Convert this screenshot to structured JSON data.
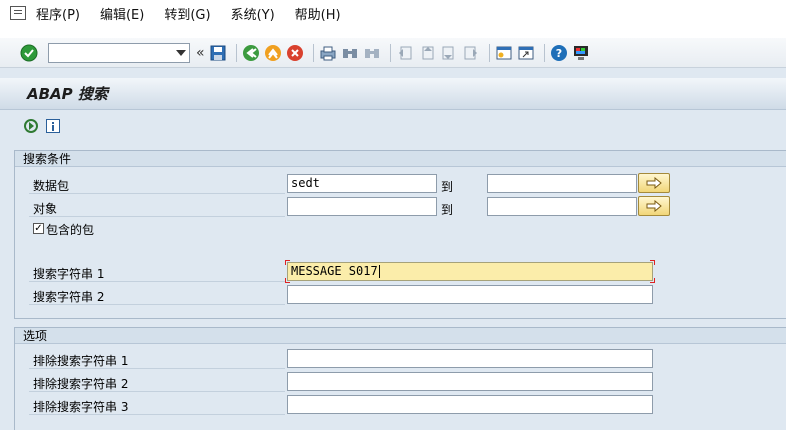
{
  "menu": {
    "items": [
      "程序(P)",
      "编辑(E)",
      "转到(G)",
      "系统(Y)",
      "帮助(H)"
    ]
  },
  "toolbar": {
    "command_field_value": "",
    "chevron": "«"
  },
  "title": "ABAP 搜索",
  "criteria": {
    "heading": "搜索条件",
    "package_label": "数据包",
    "package_from": "sedt",
    "package_to": "",
    "to_label": "到",
    "object_label": "对象",
    "object_from": "",
    "object_to": "",
    "object_to_label": "到",
    "include_sub_label": "包含的包",
    "include_sub_checked": "✓",
    "search1_label": "搜索字符串 1",
    "search1_value": "MESSAGE S017",
    "search2_label": "搜索字符串 2",
    "search2_value": ""
  },
  "options": {
    "heading": "选项",
    "exclude1_label": "排除搜索字符串 1",
    "exclude1_value": "",
    "exclude2_label": "排除搜索字符串 2",
    "exclude2_value": "",
    "exclude3_label": "排除搜索字符串 3",
    "exclude3_value": ""
  },
  "colors": {
    "background": "#dfe8f1",
    "focus_field": "#fbedaa",
    "enter_green": "#2e9a3a",
    "help_blue": "#1f6fb8"
  }
}
